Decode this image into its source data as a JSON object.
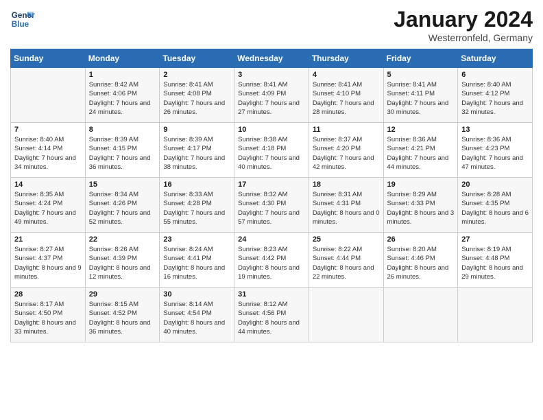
{
  "header": {
    "logo_line1": "General",
    "logo_line2": "Blue",
    "month": "January 2024",
    "location": "Westerronfeld, Germany"
  },
  "days_of_week": [
    "Sunday",
    "Monday",
    "Tuesday",
    "Wednesday",
    "Thursday",
    "Friday",
    "Saturday"
  ],
  "weeks": [
    [
      {
        "num": "",
        "sunrise": "",
        "sunset": "",
        "daylight": ""
      },
      {
        "num": "1",
        "sunrise": "Sunrise: 8:42 AM",
        "sunset": "Sunset: 4:06 PM",
        "daylight": "Daylight: 7 hours and 24 minutes."
      },
      {
        "num": "2",
        "sunrise": "Sunrise: 8:41 AM",
        "sunset": "Sunset: 4:08 PM",
        "daylight": "Daylight: 7 hours and 26 minutes."
      },
      {
        "num": "3",
        "sunrise": "Sunrise: 8:41 AM",
        "sunset": "Sunset: 4:09 PM",
        "daylight": "Daylight: 7 hours and 27 minutes."
      },
      {
        "num": "4",
        "sunrise": "Sunrise: 8:41 AM",
        "sunset": "Sunset: 4:10 PM",
        "daylight": "Daylight: 7 hours and 28 minutes."
      },
      {
        "num": "5",
        "sunrise": "Sunrise: 8:41 AM",
        "sunset": "Sunset: 4:11 PM",
        "daylight": "Daylight: 7 hours and 30 minutes."
      },
      {
        "num": "6",
        "sunrise": "Sunrise: 8:40 AM",
        "sunset": "Sunset: 4:12 PM",
        "daylight": "Daylight: 7 hours and 32 minutes."
      }
    ],
    [
      {
        "num": "7",
        "sunrise": "Sunrise: 8:40 AM",
        "sunset": "Sunset: 4:14 PM",
        "daylight": "Daylight: 7 hours and 34 minutes."
      },
      {
        "num": "8",
        "sunrise": "Sunrise: 8:39 AM",
        "sunset": "Sunset: 4:15 PM",
        "daylight": "Daylight: 7 hours and 36 minutes."
      },
      {
        "num": "9",
        "sunrise": "Sunrise: 8:39 AM",
        "sunset": "Sunset: 4:17 PM",
        "daylight": "Daylight: 7 hours and 38 minutes."
      },
      {
        "num": "10",
        "sunrise": "Sunrise: 8:38 AM",
        "sunset": "Sunset: 4:18 PM",
        "daylight": "Daylight: 7 hours and 40 minutes."
      },
      {
        "num": "11",
        "sunrise": "Sunrise: 8:37 AM",
        "sunset": "Sunset: 4:20 PM",
        "daylight": "Daylight: 7 hours and 42 minutes."
      },
      {
        "num": "12",
        "sunrise": "Sunrise: 8:36 AM",
        "sunset": "Sunset: 4:21 PM",
        "daylight": "Daylight: 7 hours and 44 minutes."
      },
      {
        "num": "13",
        "sunrise": "Sunrise: 8:36 AM",
        "sunset": "Sunset: 4:23 PM",
        "daylight": "Daylight: 7 hours and 47 minutes."
      }
    ],
    [
      {
        "num": "14",
        "sunrise": "Sunrise: 8:35 AM",
        "sunset": "Sunset: 4:24 PM",
        "daylight": "Daylight: 7 hours and 49 minutes."
      },
      {
        "num": "15",
        "sunrise": "Sunrise: 8:34 AM",
        "sunset": "Sunset: 4:26 PM",
        "daylight": "Daylight: 7 hours and 52 minutes."
      },
      {
        "num": "16",
        "sunrise": "Sunrise: 8:33 AM",
        "sunset": "Sunset: 4:28 PM",
        "daylight": "Daylight: 7 hours and 55 minutes."
      },
      {
        "num": "17",
        "sunrise": "Sunrise: 8:32 AM",
        "sunset": "Sunset: 4:30 PM",
        "daylight": "Daylight: 7 hours and 57 minutes."
      },
      {
        "num": "18",
        "sunrise": "Sunrise: 8:31 AM",
        "sunset": "Sunset: 4:31 PM",
        "daylight": "Daylight: 8 hours and 0 minutes."
      },
      {
        "num": "19",
        "sunrise": "Sunrise: 8:29 AM",
        "sunset": "Sunset: 4:33 PM",
        "daylight": "Daylight: 8 hours and 3 minutes."
      },
      {
        "num": "20",
        "sunrise": "Sunrise: 8:28 AM",
        "sunset": "Sunset: 4:35 PM",
        "daylight": "Daylight: 8 hours and 6 minutes."
      }
    ],
    [
      {
        "num": "21",
        "sunrise": "Sunrise: 8:27 AM",
        "sunset": "Sunset: 4:37 PM",
        "daylight": "Daylight: 8 hours and 9 minutes."
      },
      {
        "num": "22",
        "sunrise": "Sunrise: 8:26 AM",
        "sunset": "Sunset: 4:39 PM",
        "daylight": "Daylight: 8 hours and 12 minutes."
      },
      {
        "num": "23",
        "sunrise": "Sunrise: 8:24 AM",
        "sunset": "Sunset: 4:41 PM",
        "daylight": "Daylight: 8 hours and 16 minutes."
      },
      {
        "num": "24",
        "sunrise": "Sunrise: 8:23 AM",
        "sunset": "Sunset: 4:42 PM",
        "daylight": "Daylight: 8 hours and 19 minutes."
      },
      {
        "num": "25",
        "sunrise": "Sunrise: 8:22 AM",
        "sunset": "Sunset: 4:44 PM",
        "daylight": "Daylight: 8 hours and 22 minutes."
      },
      {
        "num": "26",
        "sunrise": "Sunrise: 8:20 AM",
        "sunset": "Sunset: 4:46 PM",
        "daylight": "Daylight: 8 hours and 26 minutes."
      },
      {
        "num": "27",
        "sunrise": "Sunrise: 8:19 AM",
        "sunset": "Sunset: 4:48 PM",
        "daylight": "Daylight: 8 hours and 29 minutes."
      }
    ],
    [
      {
        "num": "28",
        "sunrise": "Sunrise: 8:17 AM",
        "sunset": "Sunset: 4:50 PM",
        "daylight": "Daylight: 8 hours and 33 minutes."
      },
      {
        "num": "29",
        "sunrise": "Sunrise: 8:15 AM",
        "sunset": "Sunset: 4:52 PM",
        "daylight": "Daylight: 8 hours and 36 minutes."
      },
      {
        "num": "30",
        "sunrise": "Sunrise: 8:14 AM",
        "sunset": "Sunset: 4:54 PM",
        "daylight": "Daylight: 8 hours and 40 minutes."
      },
      {
        "num": "31",
        "sunrise": "Sunrise: 8:12 AM",
        "sunset": "Sunset: 4:56 PM",
        "daylight": "Daylight: 8 hours and 44 minutes."
      },
      {
        "num": "",
        "sunrise": "",
        "sunset": "",
        "daylight": ""
      },
      {
        "num": "",
        "sunrise": "",
        "sunset": "",
        "daylight": ""
      },
      {
        "num": "",
        "sunrise": "",
        "sunset": "",
        "daylight": ""
      }
    ]
  ]
}
